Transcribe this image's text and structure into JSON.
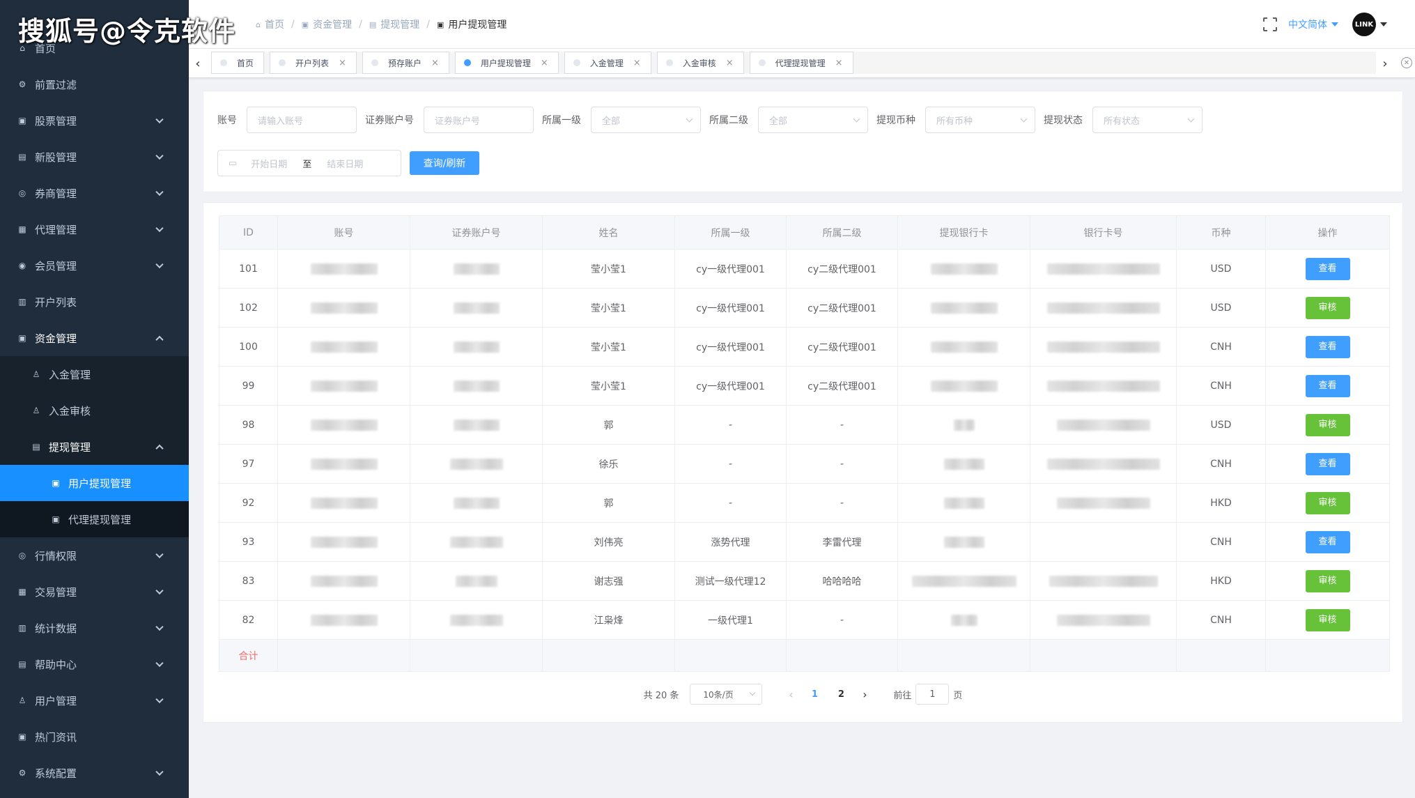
{
  "watermark": "搜狐号@令克软件",
  "sidebar": {
    "items": [
      {
        "label": "首页",
        "icon": "home-icon",
        "glyph": "⌂"
      },
      {
        "label": "前置过滤",
        "icon": "filter-icon",
        "glyph": "⚙"
      },
      {
        "label": "股票管理",
        "icon": "stock-icon",
        "glyph": "▣"
      },
      {
        "label": "新股管理",
        "icon": "ipo-icon",
        "glyph": "▤"
      },
      {
        "label": "券商管理",
        "icon": "broker-icon",
        "glyph": "◎"
      },
      {
        "label": "代理管理",
        "icon": "agent-icon",
        "glyph": "▦"
      },
      {
        "label": "会员管理",
        "icon": "member-icon",
        "glyph": "◉"
      },
      {
        "label": "开户列表",
        "icon": "account-list-icon",
        "glyph": "▥"
      },
      {
        "label": "资金管理",
        "icon": "fund-icon",
        "glyph": "▣"
      },
      {
        "label": "入金管理",
        "icon": "deposit-icon",
        "glyph": "♙"
      },
      {
        "label": "入金审核",
        "icon": "deposit-audit-icon",
        "glyph": "♙"
      },
      {
        "label": "提现管理",
        "icon": "withdraw-icon",
        "glyph": "▤"
      },
      {
        "label": "用户提现管理",
        "icon": "user-withdraw-icon",
        "glyph": "▣"
      },
      {
        "label": "代理提现管理",
        "icon": "agent-withdraw-icon",
        "glyph": "▣"
      },
      {
        "label": "行情权限",
        "icon": "quote-icon",
        "glyph": "◎"
      },
      {
        "label": "交易管理",
        "icon": "trade-icon",
        "glyph": "▦"
      },
      {
        "label": "统计数据",
        "icon": "stats-icon",
        "glyph": "▥"
      },
      {
        "label": "帮助中心",
        "icon": "help-icon",
        "glyph": "▤"
      },
      {
        "label": "用户管理",
        "icon": "user-icon",
        "glyph": "♙"
      },
      {
        "label": "热门资讯",
        "icon": "news-icon",
        "glyph": "▣"
      },
      {
        "label": "系统配置",
        "icon": "settings-icon",
        "glyph": "⚙"
      }
    ]
  },
  "header": {
    "breadcrumb": [
      "首页",
      "资金管理",
      "提现管理",
      "用户提现管理"
    ],
    "language": "中文简体",
    "avatar_text": "LINK"
  },
  "tabs": [
    {
      "label": "首页",
      "closable": false
    },
    {
      "label": "开户列表",
      "closable": true
    },
    {
      "label": "预存账户",
      "closable": true
    },
    {
      "label": "用户提现管理",
      "closable": true,
      "active": true
    },
    {
      "label": "入金管理",
      "closable": true
    },
    {
      "label": "入金审核",
      "closable": true
    },
    {
      "label": "代理提现管理",
      "closable": true
    }
  ],
  "filter": {
    "account_label": "账号",
    "account_placeholder": "请输入账号",
    "sec_label": "证券账户号",
    "sec_placeholder": "证券账户号",
    "level1_label": "所属一级",
    "level1_value": "全部",
    "level2_label": "所属二级",
    "level2_value": "全部",
    "currency_label": "提现币种",
    "currency_value": "所有币种",
    "status_label": "提现状态",
    "status_value": "所有状态",
    "start_placeholder": "开始日期",
    "date_sep": "至",
    "end_placeholder": "结束日期",
    "query_button": "查询/刷新"
  },
  "table": {
    "columns": [
      "ID",
      "账号",
      "证券账户号",
      "姓名",
      "所属一级",
      "所属二级",
      "提现银行卡",
      "银行卡号",
      "币种",
      "操作"
    ],
    "rows": [
      {
        "id": "101",
        "name": "莹小莹1",
        "l1": "cy一级代理001",
        "l2": "cy二级代理001",
        "currency": "USD",
        "action": "查看"
      },
      {
        "id": "102",
        "name": "莹小莹1",
        "l1": "cy一级代理001",
        "l2": "cy二级代理001",
        "currency": "USD",
        "action": "审核"
      },
      {
        "id": "100",
        "name": "莹小莹1",
        "l1": "cy一级代理001",
        "l2": "cy二级代理001",
        "currency": "CNH",
        "action": "查看"
      },
      {
        "id": "99",
        "name": "莹小莹1",
        "l1": "cy一级代理001",
        "l2": "cy二级代理001",
        "currency": "CNH",
        "action": "查看"
      },
      {
        "id": "98",
        "name": "郭",
        "l1": "-",
        "l2": "-",
        "currency": "USD",
        "action": "审核"
      },
      {
        "id": "97",
        "name": "徐乐",
        "l1": "-",
        "l2": "-",
        "currency": "CNH",
        "action": "查看"
      },
      {
        "id": "92",
        "name": "郭",
        "l1": "-",
        "l2": "-",
        "currency": "HKD",
        "action": "审核"
      },
      {
        "id": "93",
        "name": "刘伟亮",
        "l1": "涨势代理",
        "l2": "李雷代理",
        "currency": "CNH",
        "action": "查看"
      },
      {
        "id": "83",
        "name": "谢志强",
        "l1": "测试一级代理12",
        "l2": "哈哈哈哈",
        "currency": "HKD",
        "action": "审核"
      },
      {
        "id": "82",
        "name": "江枭烽",
        "l1": "一级代理1",
        "l2": "-",
        "currency": "CNH",
        "action": "审核"
      }
    ],
    "summary_label": "合计"
  },
  "pagination": {
    "total_text": "共 20 条",
    "page_size": "10条/页",
    "pages": [
      "1",
      "2"
    ],
    "current": "1",
    "goto_prefix": "前往",
    "goto_value": "1",
    "goto_suffix": "页"
  },
  "colors": {
    "sidebar_bg": "#1f2d3d",
    "active_menu": "#1890ff",
    "primary": "#409eff",
    "success": "#67c23a",
    "danger": "#f56c6c"
  }
}
